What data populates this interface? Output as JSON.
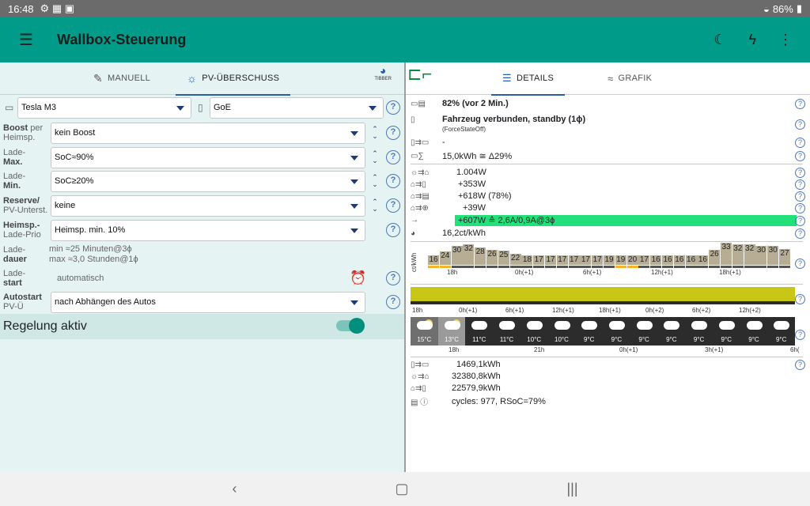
{
  "status": {
    "time": "16:48",
    "battery": "86%"
  },
  "app": {
    "title": "Wallbox-Steuerung"
  },
  "left": {
    "tabs": [
      {
        "label": "MANUELL"
      },
      {
        "label": "PV-ÜBERSCHUSS"
      }
    ],
    "tibber": "TIBBER",
    "car": "Tesla M3",
    "wallbox": "GoE",
    "rows": [
      {
        "label_a": "Boost",
        "label_b": " per",
        "label_c": "Heimsp.",
        "value": "kein Boost"
      },
      {
        "label_a": "Lade-",
        "label_b": "",
        "label_c": "Max.",
        "value": "SoC≈90%"
      },
      {
        "label_a": "Lade-",
        "label_b": "",
        "label_c": "Min.",
        "value": "SoC≥20%"
      },
      {
        "label_a": "Reserve/",
        "label_b": "",
        "label_c": "PV-Unterst.",
        "value": "keine"
      },
      {
        "label_a": "Heimsp.-",
        "label_b": "",
        "label_c": "Lade-Prio",
        "value": "Heimsp. min. 10%"
      }
    ],
    "ladedauer": {
      "label_a": "Lade-",
      "label_b": "dauer",
      "v1": "min ≈25 Minuten@3ϕ",
      "v2": "max ≈3,0 Stunden@1ϕ"
    },
    "ladestart": {
      "label_a": "Lade-",
      "label_b": "start",
      "value": "automatisch"
    },
    "autostart": {
      "label_a": "Autostart",
      "label_b": "PV-Ü",
      "value": "nach Abhängen des Autos"
    },
    "regelung": "Regelung aktiv"
  },
  "right": {
    "tabs": [
      {
        "label": "DETAILS"
      },
      {
        "label": "GRAFIK"
      }
    ],
    "soc": "82% (vor 2 Min.)",
    "state": "Fahrzeug verbunden, standby (1ϕ)",
    "state_sub": "(ForceStateOff)",
    "dash": "-",
    "energy": "15,0kWh ≅ Δ29%",
    "pv": "1.004W",
    "home": "+353W",
    "battery": "+618W (78%)",
    "grid": "+39W",
    "charge": "+607W ≙ 2,6A/0,9A@3ϕ",
    "price": "16,2ct/kWh",
    "ct_label": "ct/kWh",
    "prices": [
      16,
      24,
      30,
      32,
      28,
      26,
      25,
      22,
      18,
      17,
      17,
      17,
      17,
      17,
      17,
      19,
      19,
      20,
      17,
      16,
      16,
      16,
      16,
      16,
      26,
      33,
      32,
      32,
      30,
      30,
      27
    ],
    "price_ticks": [
      "18h",
      "0h(+1)",
      "6h(+1)",
      "12h(+1)",
      "18h(+1)"
    ],
    "pv_ticks": [
      "18h",
      "0h(+1)",
      "6h(+1)",
      "12h(+1)",
      "18h(+1)",
      "0h(+2)",
      "6h(+2)",
      "12h(+2)"
    ],
    "weather_temps": [
      "15°C",
      "13°C",
      "11°C",
      "11°C",
      "10°C",
      "10°C",
      "9°C",
      "9°C",
      "9°C",
      "9°C",
      "9°C",
      "9°C",
      "9°C",
      "9°C"
    ],
    "weather_ticks": [
      "18h",
      "21h",
      "0h(+1)",
      "3h(+1)",
      "6h("
    ],
    "totals": [
      "1469,1kWh",
      "32380,8kWh",
      "22579,9kWh",
      "cycles: 977, RSoC=79%"
    ]
  }
}
